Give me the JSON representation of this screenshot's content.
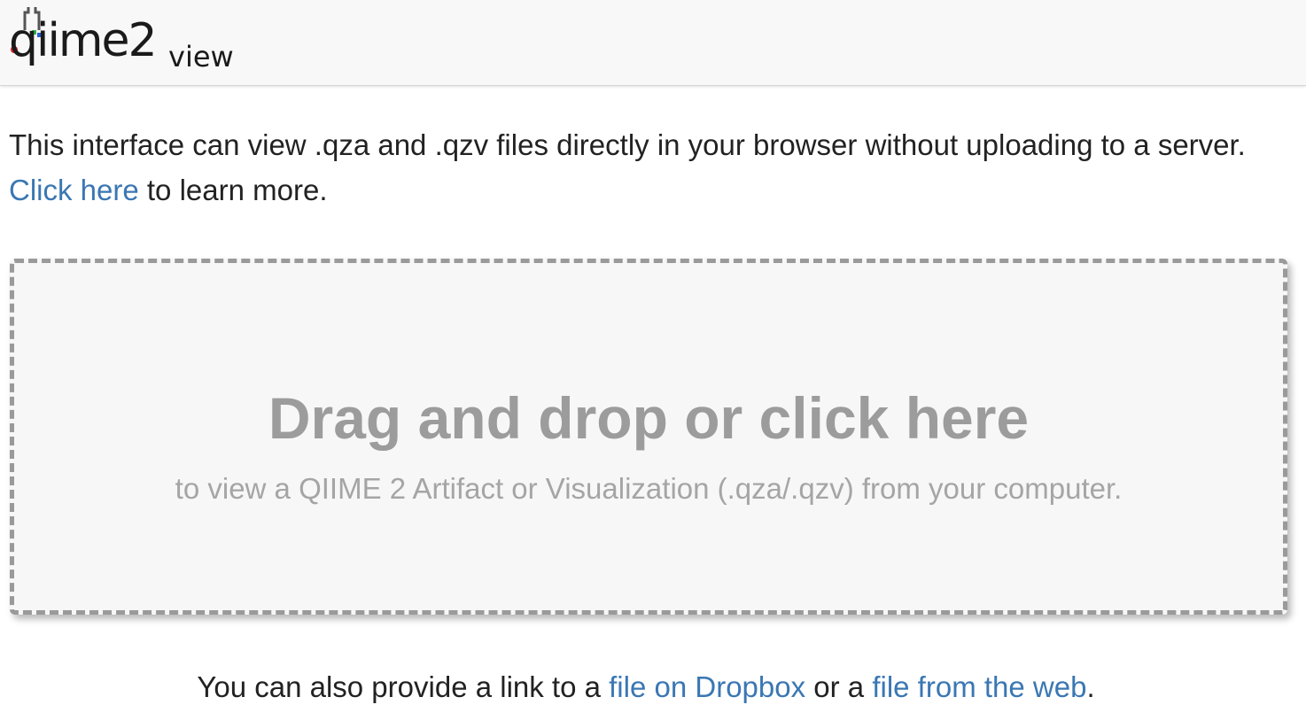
{
  "header": {
    "logo": {
      "main": "qiime2",
      "suffix": "view",
      "accent_colors": [
        "#e21f26",
        "#2fb34a",
        "#2d5bd8",
        "#555555"
      ]
    }
  },
  "intro": {
    "text_before": "This interface can view .qza and .qzv files directly in your browser without uploading to a server.",
    "link_label": "Click here",
    "text_after": "to learn more."
  },
  "dropzone": {
    "title": "Drag and drop or click here",
    "subtitle": "to view a QIIME 2 Artifact or Visualization (.qza/.qzv) from your computer."
  },
  "footer": {
    "text_before": "You can also provide a link to a",
    "link1_label": "file on Dropbox",
    "text_middle": "or a",
    "link2_label": "file from the web",
    "text_after": "."
  },
  "colors": {
    "link": "#3a77b3",
    "dropzone_text": "#9c9c9c",
    "navbar_bg": "#f8f8f8"
  }
}
